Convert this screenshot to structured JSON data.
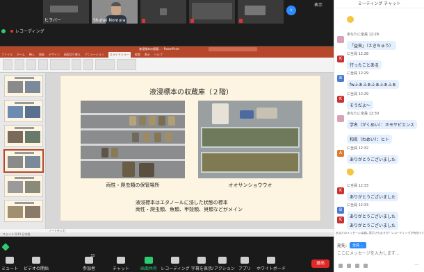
{
  "zoom": {
    "participants": [
      {
        "name": "ヒラバー",
        "type": "blurred",
        "muted": false
      },
      {
        "name": "Shuhei Nomura",
        "type": "face",
        "muted": false
      },
      {
        "name": "",
        "type": "blurred",
        "muted": true
      },
      {
        "name": "",
        "type": "blurred",
        "muted": true
      },
      {
        "name": "",
        "type": "blurred",
        "muted": true
      }
    ],
    "view_label": "表示",
    "next_icon": "›",
    "recording_label": "レコーディング"
  },
  "ppt": {
    "window_title": "液浸標本の保管... - PowerPoint",
    "tabs": [
      "ファイル",
      "ホーム",
      "挿入",
      "描画",
      "デザイン",
      "画面切り替え",
      "アニメーション",
      "スライドショー",
      "校閲",
      "表示",
      "ヘルプ"
    ],
    "active_tab": "スライドショー",
    "notes_label": "ノートを入力",
    "status_text": "スライド 8/10 日本語"
  },
  "slide": {
    "title": "液浸標本の収蔵庫（２階）",
    "caption1": "両性・爬虫類の保管場所",
    "caption2": "オオサンショウウオ",
    "desc_line1": "液浸標本はエタノールに浸した状態の標本",
    "desc_line2": "両性・爬虫類、魚類、甲殻類、貝類などがメイン"
  },
  "toolbar": {
    "mute": "ミュート",
    "video": "ビデオの開始",
    "participants": "参加者",
    "participants_count": "33",
    "chat": "チャット",
    "share": "画面共有",
    "record": "レコーディング",
    "captions": "字幕を表示",
    "reactions": "リアクション",
    "apps": "アプリ",
    "whiteboard": "ホワイトボード",
    "end": "退出"
  },
  "chat": {
    "header": "ミーティング チャット",
    "messages": [
      {
        "avatar": "",
        "avatar_style": "none",
        "meta": "",
        "text": "",
        "emoji": "face"
      },
      {
        "avatar": "",
        "avatar_style": "p",
        "meta": "あなたに全員 12:28",
        "text": "「益虫」（えきちゅう）",
        "emoji": ""
      },
      {
        "avatar": "K",
        "avatar_style": "k",
        "meta": "に全員 12:28",
        "text": "行ったことある",
        "emoji": ""
      },
      {
        "avatar": "B",
        "avatar_style": "b",
        "meta": "に全員 12:29",
        "text": "fwふぁふぁふぁふぁふぁ",
        "emoji": ""
      },
      {
        "avatar": "K",
        "avatar_style": "k",
        "meta": "に全員 12:29",
        "text": "そうだよ～",
        "emoji": ""
      },
      {
        "avatar": "",
        "avatar_style": "p",
        "meta": "あなたに全員 12:30",
        "text": "学名（がくめい）：ホモサピエンス",
        "emoji": ""
      },
      {
        "avatar": "",
        "avatar_style": "none",
        "meta": "",
        "text": "和名（わめい）：ヒト",
        "emoji": ""
      },
      {
        "avatar": "A",
        "avatar_style": "a",
        "meta": "に全員 12:32",
        "text": "ありがとうございました",
        "emoji": ""
      },
      {
        "avatar": "",
        "avatar_style": "none",
        "meta": "",
        "text": "",
        "emoji": "wave"
      },
      {
        "avatar": "K",
        "avatar_style": "k",
        "meta": "に全員 12:33",
        "text": "ありがとうございました",
        "emoji": ""
      },
      {
        "avatar": "B",
        "avatar_style": "b",
        "meta": "に全員 12:33",
        "text": "ありがとうございました",
        "emoji": ""
      },
      {
        "avatar": "K",
        "avatar_style": "k",
        "meta": "",
        "text": "ありがとうございました",
        "emoji": ""
      }
    ],
    "notice": "あなたのメッセージは誰に表示されますか？レコーディングが有効です",
    "to_label": "宛先:",
    "to_value": "全員 ⌄",
    "input_placeholder": "ここにメッセージを入力します...",
    "more_icon": "···"
  }
}
